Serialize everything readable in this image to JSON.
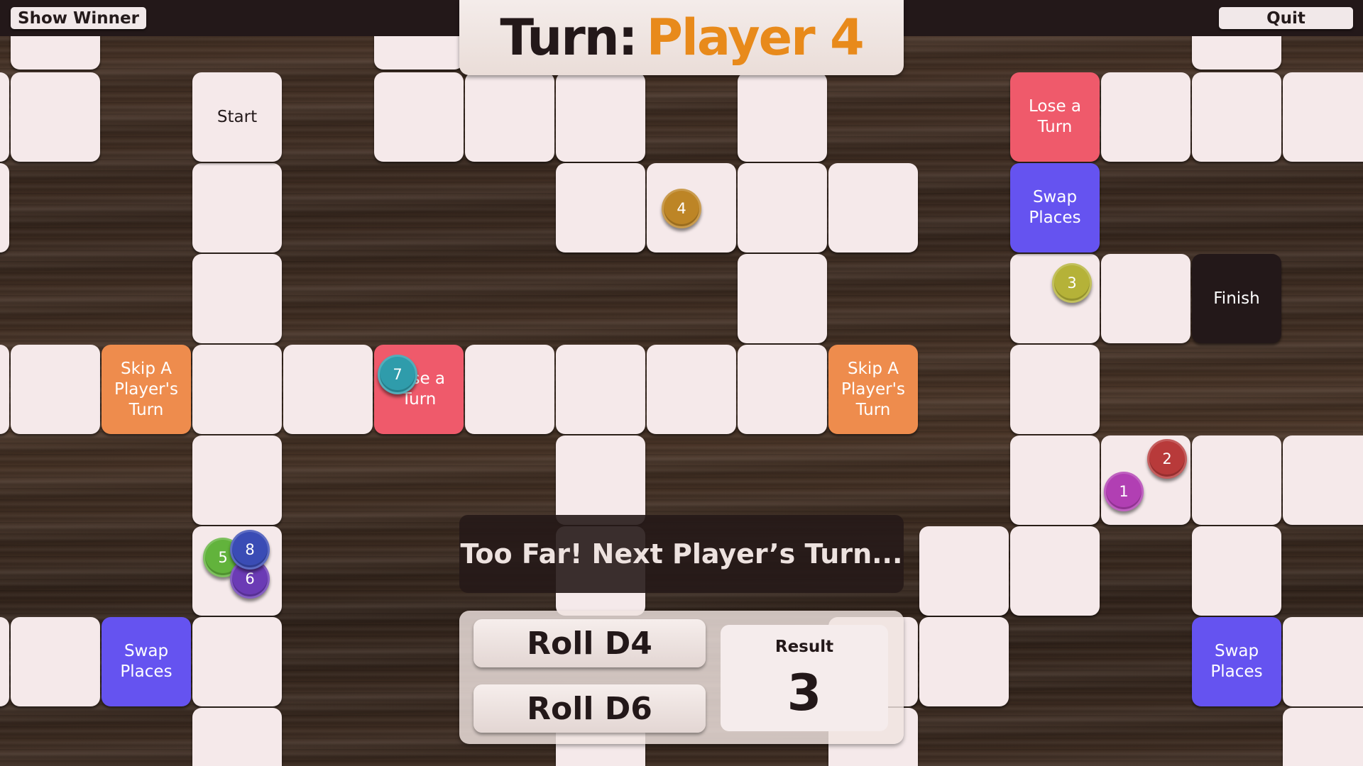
{
  "topbar": {
    "show_winner_label": "Show Winner",
    "quit_label": "Quit"
  },
  "turn": {
    "label": "Turn:",
    "player": "Player 4",
    "player_color": "#e88a1b"
  },
  "board": {
    "special_tiles": [
      {
        "id": "start",
        "type": "start",
        "label": "Start"
      },
      {
        "id": "lose-top",
        "type": "lose",
        "label": "Lose a Turn"
      },
      {
        "id": "swap-right-top",
        "type": "swap",
        "label": "Swap Places"
      },
      {
        "id": "finish",
        "type": "finish",
        "label": "Finish"
      },
      {
        "id": "skip-left",
        "type": "skip",
        "label": "Skip A Player's Turn"
      },
      {
        "id": "lose-mid",
        "type": "lose",
        "label": "Lose a Turn"
      },
      {
        "id": "skip-mid",
        "type": "skip",
        "label": "Skip A Player's Turn"
      },
      {
        "id": "swap-left-bottom",
        "type": "swap",
        "label": "Swap Places"
      },
      {
        "id": "swap-right-bottom",
        "type": "swap",
        "label": "Swap Places"
      }
    ],
    "tile_colors": {
      "plain": "#f5e9ea",
      "lose": "#ef5a6b",
      "swap": "#6553f0",
      "skip": "#ee8c4d",
      "finish": "#231819"
    }
  },
  "tokens": [
    {
      "label": "4",
      "color": "#bd8526"
    },
    {
      "label": "3",
      "color": "#b5b238"
    },
    {
      "label": "7",
      "color": "#2f9cab"
    },
    {
      "label": "2",
      "color": "#b83a3a"
    },
    {
      "label": "1",
      "color": "#b13fb3"
    },
    {
      "label": "5",
      "color": "#62b33c"
    },
    {
      "label": "6",
      "color": "#6b3bb5"
    },
    {
      "label": "8",
      "color": "#3a4cb5"
    }
  ],
  "message": "Too Far! Next Player’s Turn...",
  "dice": {
    "roll_d4_label": "Roll D4",
    "roll_d6_label": "Roll D6",
    "result_label": "Result",
    "result_value": "3"
  }
}
